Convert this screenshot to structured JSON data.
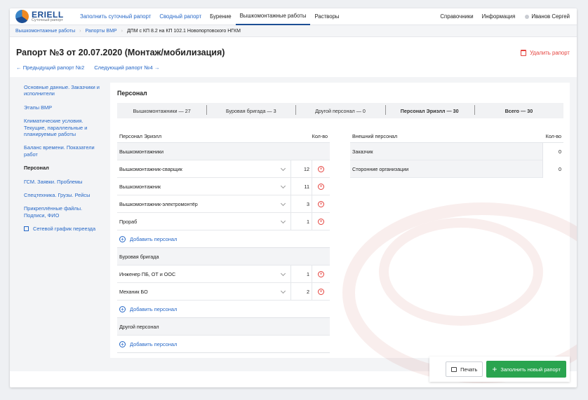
{
  "brand": {
    "name": "ERIELL",
    "subtitle": "Суточный рапорт"
  },
  "nav": {
    "items": [
      {
        "label": "Заполнить суточный рапорт",
        "style": "blue"
      },
      {
        "label": "Сводный рапорт",
        "style": "blue"
      },
      {
        "label": "Бурение",
        "style": "normal"
      },
      {
        "label": "Вышкомонтажные работы",
        "style": "active"
      },
      {
        "label": "Растворы",
        "style": "normal"
      }
    ],
    "right": [
      "Справочники",
      "Информация"
    ],
    "user": "Иванов Сергей"
  },
  "breadcrumb": {
    "items": [
      "Вышкомонтажные работы",
      "Рапорты ВМР"
    ],
    "current": "ДПМ с КП 8.2 на КП 102.1 Новопортовского НГКМ"
  },
  "page": {
    "title": "Рапорт №3 от 20.07.2020 (Монтаж/мобилизация)",
    "delete_label": "Удалить рапорт",
    "prev_label": "← Предыдущий рапорт №2",
    "next_label": "Следующий рапорт №4 →"
  },
  "sidebar": {
    "items": [
      {
        "label": "Основные данные. Заказчики и исполнители"
      },
      {
        "label": "Этапы ВМР"
      },
      {
        "label": "Климатические условия. Текущие, параллельные и планируемые работы"
      },
      {
        "label": "Баланс времени. Показатели работ"
      },
      {
        "label": "Персонал",
        "active": true
      },
      {
        "label": "ГСМ. Заявки. Проблемы"
      },
      {
        "label": "Спецтехника. Грузы. Рейсы"
      },
      {
        "label": "Прикреплённые файлы. Подписи, ФИО"
      },
      {
        "label": "Сетевой график переезда",
        "external": true
      }
    ]
  },
  "personnel": {
    "title": "Персонал",
    "summary": [
      {
        "label": "Вышкомонтажники — 27",
        "bold": false
      },
      {
        "label": "Буровая бригада — 3",
        "bold": false
      },
      {
        "label": "Другой персонал — 0",
        "bold": false
      },
      {
        "label": "Персонал Эриэлл — 30",
        "bold": true
      },
      {
        "label": "Всего — 30",
        "bold": true
      }
    ],
    "table": {
      "header": "Персонал Эриэлл",
      "qty_header": "Кол-во",
      "add_label": "Добавить персонал",
      "groups": [
        {
          "name": "Вышкомонтажники",
          "rows": [
            {
              "role": "Вышкомонтажник-сварщик",
              "qty": "12"
            },
            {
              "role": "Вышкомонтажник",
              "qty": "11"
            },
            {
              "role": "Вышкомонтажник-электромонтёр",
              "qty": "3"
            },
            {
              "role": "Прораб",
              "qty": "1"
            }
          ]
        },
        {
          "name": "Буровая бригада",
          "rows": [
            {
              "role": "Инженер ПБ, ОТ и ООС",
              "qty": "1"
            },
            {
              "role": "Механик БО",
              "qty": "2"
            }
          ]
        },
        {
          "name": "Другой персонал",
          "rows": []
        }
      ]
    },
    "external": {
      "header": "Внешний персонал",
      "qty_header": "Кол-во",
      "rows": [
        {
          "name": "Заказчик",
          "qty": "0"
        },
        {
          "name": "Сторонние организации",
          "qty": "0"
        }
      ]
    }
  },
  "actions": {
    "print_label": "Печать",
    "new_label": "Заполнить новый рапорт"
  },
  "colors": {
    "link": "#2567c7",
    "brand": "#1d4f95",
    "danger": "#e5423d",
    "success": "#2aa44f"
  }
}
